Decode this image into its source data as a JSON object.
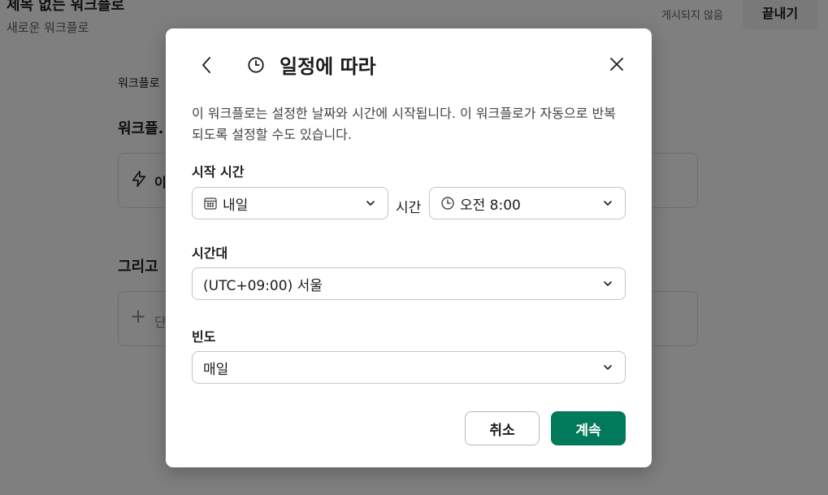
{
  "background": {
    "title": "제목 없는 워크플로",
    "subtitle": "새로운 워크플로",
    "status": "게시되지 않음",
    "finish_label": "끝내기",
    "description_partial": "워크플로",
    "heading1_partial": "워크플.",
    "card1_partial": "이",
    "heading2_partial": "그리고",
    "card2_partial": "단"
  },
  "modal": {
    "title": "일정에 따라",
    "description": "이 워크플로는 설정한 날짜와 시간에 시작됩니다. 이 워크플로가 자동으로 반복되도록 설정할 수도 있습니다.",
    "start_time_label": "시작 시간",
    "date_value": "내일",
    "time_label": "시간",
    "time_value": "오전 8:00",
    "timezone_label": "시간대",
    "timezone_value": "(UTC+09:00) 서울",
    "frequency_label": "빈도",
    "frequency_value": "매일",
    "cancel_label": "취소",
    "continue_label": "계속"
  },
  "icons": {
    "back": "chevron-left-icon",
    "header": "clock-icon",
    "close": "close-icon",
    "date": "calendar-icon",
    "time": "clock-icon",
    "dropdown": "chevron-down-icon",
    "trigger": "lightning-icon",
    "add": "plus-icon"
  },
  "colors": {
    "primary": "#007a5a",
    "overlay": "rgba(0,0,0,0.5)"
  }
}
